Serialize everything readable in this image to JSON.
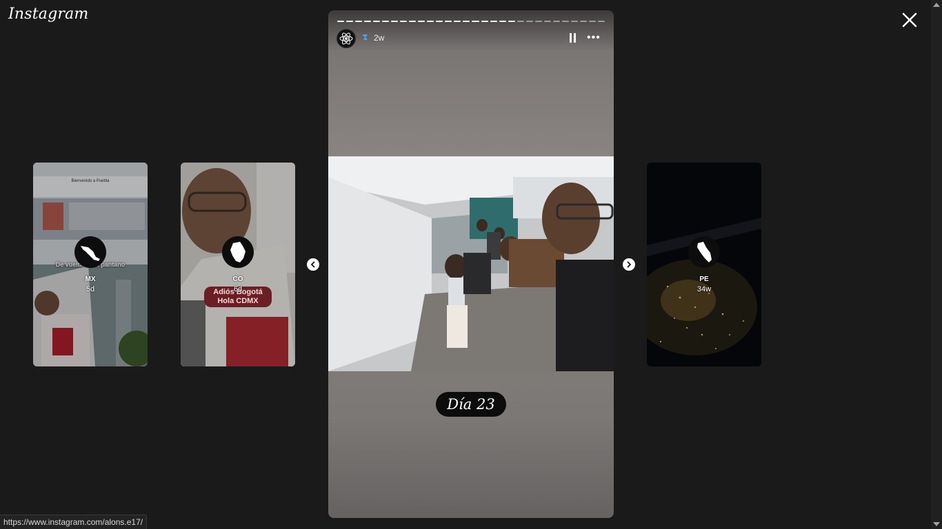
{
  "app": {
    "logo_text": "Instagram"
  },
  "previews": [
    {
      "username": "MX",
      "age": "5d",
      "overlay_text": "De vuelta en el pantano",
      "sign_text": "Bienvenido a Puebla",
      "avatar_icon": "mexico-map-icon"
    },
    {
      "username": "CO",
      "age": "6d",
      "pill_text": "Adiós Bogotá Hola CDMX",
      "avatar_icon": "colombia-map-icon"
    },
    {
      "username": "PE",
      "age": "34w",
      "avatar_icon": "peru-map-icon"
    }
  ],
  "story": {
    "age": "2w",
    "caption": "Día 23",
    "segments_total": 30,
    "segments_done": 20,
    "controls": {
      "pause_icon": "pause-icon",
      "more_icon": "more-icon"
    }
  },
  "status_bar": {
    "url": "https://www.instagram.com/alons.e17/"
  },
  "colors": {
    "background": "#1a1a1a",
    "pill": "#6b1f24"
  }
}
